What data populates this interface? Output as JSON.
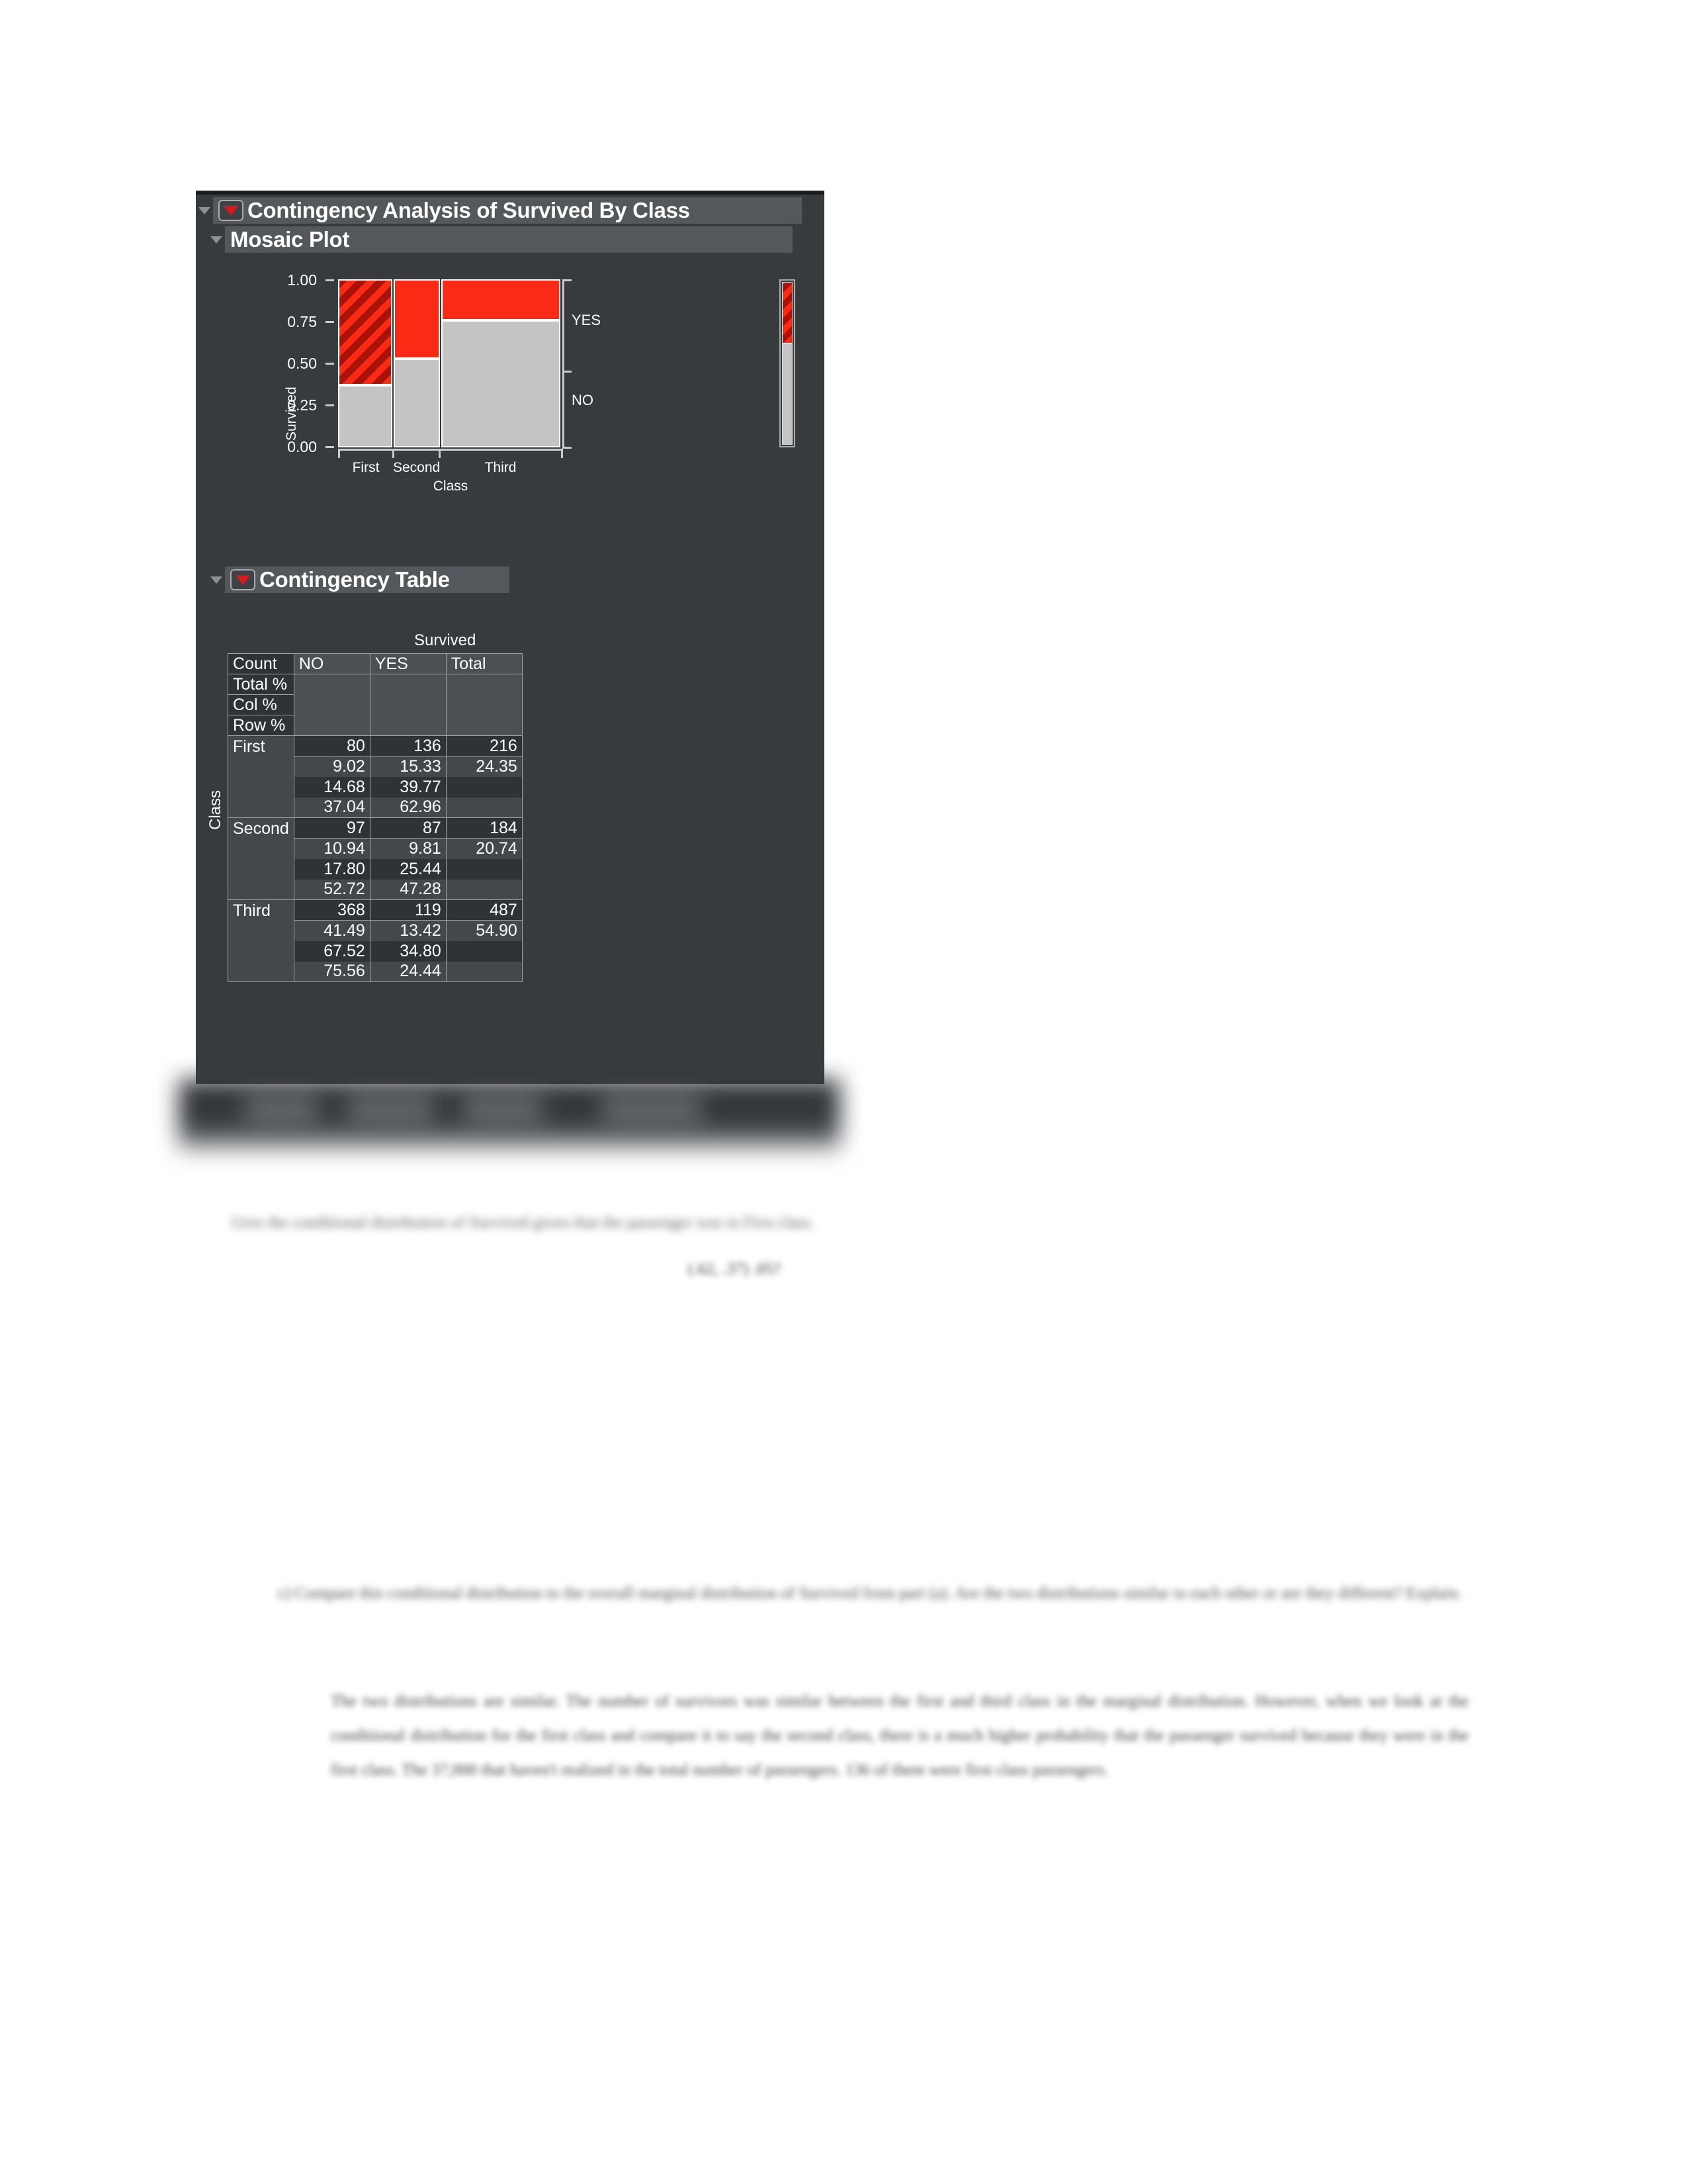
{
  "window": {
    "outline_title": "Contingency Analysis of Survived By Class",
    "sections": [
      {
        "title": "Mosaic Plot"
      },
      {
        "title": "Contingency Table"
      }
    ]
  },
  "chart_data": {
    "type": "mosaic",
    "title": "Mosaic Plot",
    "xlabel": "Class",
    "ylabel": "Survived",
    "categories": [
      "First",
      "Second",
      "Third"
    ],
    "response_levels": [
      "YES",
      "NO"
    ],
    "ytick_labels": [
      "0.00",
      "0.25",
      "0.50",
      "0.75",
      "1.00"
    ],
    "ylim": [
      0,
      1
    ],
    "right_labels": [
      "YES",
      "NO"
    ],
    "column_widths_pct": [
      24.35,
      20.74,
      54.9
    ],
    "series": [
      {
        "name": "YES",
        "values": [
          62.96,
          47.28,
          24.44
        ],
        "color": "#fb2a15"
      },
      {
        "name": "NO",
        "values": [
          37.04,
          52.72,
          75.56
        ],
        "color": "#c4c4c4"
      }
    ],
    "selected_category": "First",
    "marginal": {
      "YES": 37.75,
      "NO": 62.25
    }
  },
  "contingency_table": {
    "col_group_label": "Survived",
    "row_group_label": "Class",
    "stat_labels": [
      "Count",
      "Total %",
      "Col %",
      "Row %"
    ],
    "column_headers": [
      "NO",
      "YES",
      "Total"
    ],
    "rows": [
      {
        "label": "First",
        "count": [
          "80",
          "136",
          "216"
        ],
        "total_pct": [
          "9.02",
          "15.33",
          "24.35"
        ],
        "col_pct": [
          "14.68",
          "39.77",
          ""
        ],
        "row_pct": [
          "37.04",
          "62.96",
          ""
        ]
      },
      {
        "label": "Second",
        "count": [
          "97",
          "87",
          "184"
        ],
        "total_pct": [
          "10.94",
          "9.81",
          "20.74"
        ],
        "col_pct": [
          "17.80",
          "25.44",
          ""
        ],
        "row_pct": [
          "52.72",
          "47.28",
          ""
        ]
      },
      {
        "label": "Third",
        "count": [
          "368",
          "119",
          "487"
        ],
        "total_pct": [
          "41.49",
          "13.42",
          "54.90"
        ],
        "col_pct": [
          "67.52",
          "34.80",
          ""
        ],
        "row_pct": [
          "75.56",
          "24.44",
          ""
        ]
      }
    ]
  },
  "document": {
    "caption_line": "Give the conditional distribution of Survived given that the passenger was in First class.",
    "caption_sub": "(.62, .37) .05?",
    "question": "c)  Compare this conditional distribution to the overall marginal distribution of Survived from part (a). Are the two distributions similar to each other or are they different? Explain.",
    "answer": "The two distributions are similar. The number of survivors was similar between the first and third class in the marginal distribution. However, when we look at the conditional distribution for the first class and compare it to say the second class, there is a much higher probability that the passenger survived because they were in the first class. The 37,000 that haven't realized in the total number of passengers. 136 of them were first class passengers."
  },
  "colors": {
    "window_bg": "#383b3e",
    "header_bar": "#54585c",
    "yes": "#fb2a15",
    "no": "#c4c4c4",
    "accent_red": "#d71a20"
  }
}
